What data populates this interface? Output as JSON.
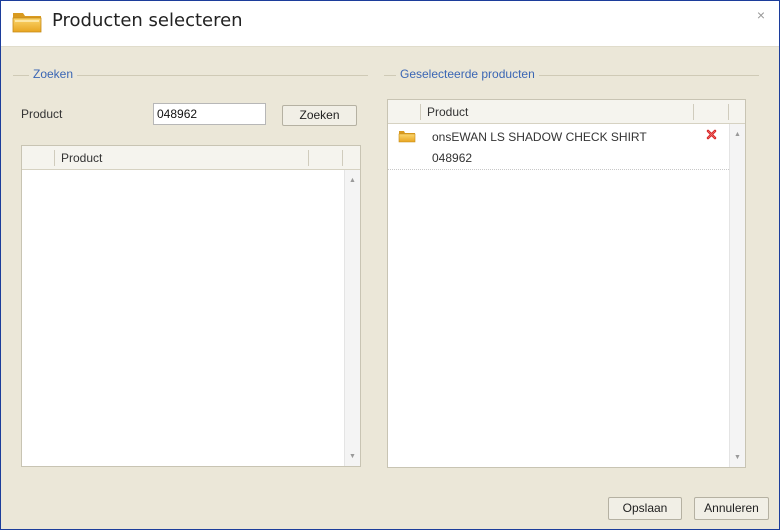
{
  "dialog": {
    "title": "Producten selecteren",
    "close_glyph": "×",
    "icon": "folder-icon"
  },
  "search": {
    "legend": "Zoeken",
    "product_label": "Product",
    "product_value": "048962",
    "button_label": "Zoeken",
    "results_grid": {
      "column_header": "Product",
      "rows": []
    }
  },
  "selected": {
    "legend": "Geselecteerde producten",
    "grid": {
      "column_header": "Product",
      "rows": [
        {
          "name": "onsEWAN LS SHADOW CHECK SHIRT",
          "code": "048962",
          "icon": "folder-icon",
          "action_icon": "remove-icon"
        }
      ]
    }
  },
  "footer": {
    "save_label": "Opslaan",
    "cancel_label": "Annuleren"
  },
  "colors": {
    "border": "#1c3d9b",
    "background": "#ebe7d8",
    "legend": "#3a66b4",
    "remove": "#d41c1c"
  }
}
